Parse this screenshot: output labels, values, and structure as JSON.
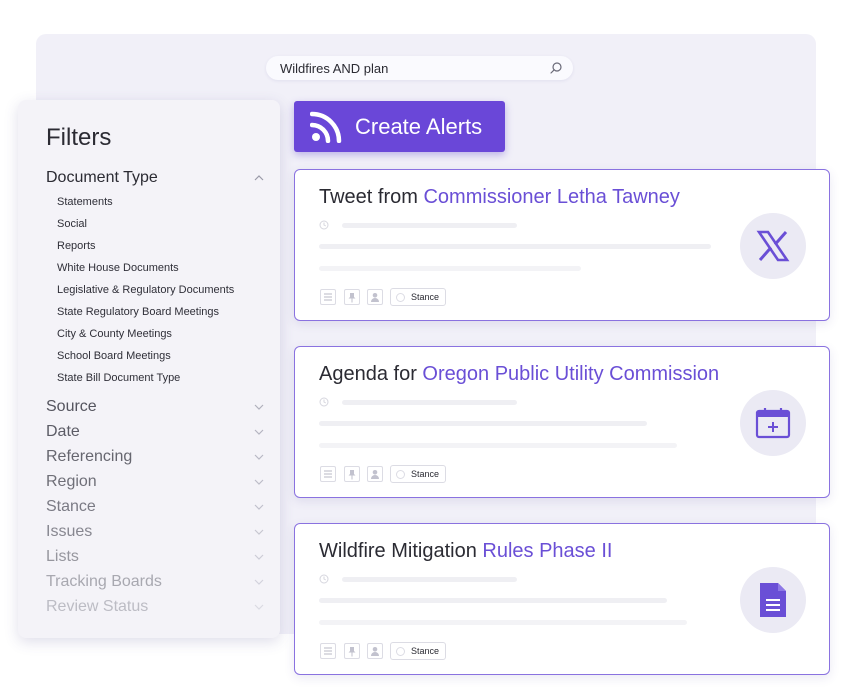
{
  "search": {
    "query": "Wildfires AND plan",
    "icon": "search-icon"
  },
  "filters": {
    "title": "Filters",
    "document_type": {
      "label": "Document Type",
      "items": [
        "Statements",
        "Social",
        "Reports",
        "White House Documents",
        "Legislative & Regulatory Documents",
        "State Regulatory Board Meetings",
        "City & County Meetings",
        "School Board Meetings",
        "State Bill Document Type"
      ]
    },
    "sections": [
      "Source",
      "Date",
      "Referencing",
      "Region",
      "Stance",
      "Issues",
      "Lists",
      "Tracking Boards",
      "Review Status"
    ]
  },
  "create_alerts": {
    "label": "Create Alerts",
    "icon": "rss-icon"
  },
  "results": [
    {
      "type_label": "Tweet",
      "connector": " from ",
      "entity": "Commissioner Letha Tawney",
      "badge_icon": "x-logo-icon",
      "stance_label": "Stance"
    },
    {
      "type_label": "Agenda",
      "connector": " for ",
      "entity": "Oregon Public Utility Commission",
      "badge_icon": "calendar-icon",
      "stance_label": "Stance"
    },
    {
      "type_label": "Wildfire Mitigation",
      "connector": " ",
      "entity": "Rules Phase II",
      "badge_icon": "document-icon",
      "stance_label": "Stance"
    }
  ],
  "colors": {
    "accent": "#6a47d8",
    "accent_text": "#6a4fd6",
    "card_border": "#8a72e0",
    "badge_bg": "#ebeaf4"
  }
}
